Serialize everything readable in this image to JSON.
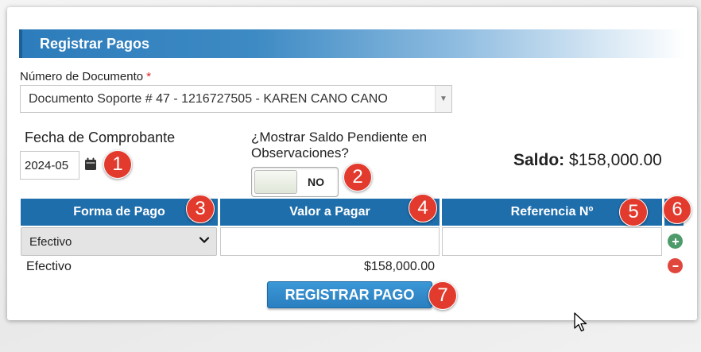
{
  "form": {
    "title": "Registrar Pagos",
    "document_label": "Número de Documento",
    "required_mark": "*",
    "document_value": "Documento Soporte # 47 - 1216727505 - KAREN CANO CANO",
    "fecha_label": "Fecha de Comprobante",
    "fecha_value": "2024-05",
    "saldo_question": "¿Mostrar Saldo Pendiente en Observaciones?",
    "toggle_label": "NO",
    "saldo_label": "Saldo:",
    "saldo_value": "$158,000.00"
  },
  "table": {
    "headers": [
      "Forma de Pago",
      "Valor a Pagar",
      "Referencia Nº"
    ],
    "input_row": {
      "forma_pago": "Efectivo",
      "valor": "",
      "referencia": ""
    },
    "rows": [
      {
        "forma_pago": "Efectivo",
        "valor": "$158,000.00"
      }
    ]
  },
  "submit_label": "REGISTRAR PAGO",
  "badges": [
    "1",
    "2",
    "3",
    "4",
    "5",
    "6",
    "7"
  ],
  "colors": {
    "accent": "#1f6eac",
    "badge": "#e23b2e",
    "add": "#4d9a6a",
    "remove": "#e0463c"
  },
  "icons": [
    "calendar-icon",
    "chevron-down-icon",
    "plus-icon",
    "minus-icon",
    "cursor-icon"
  ]
}
